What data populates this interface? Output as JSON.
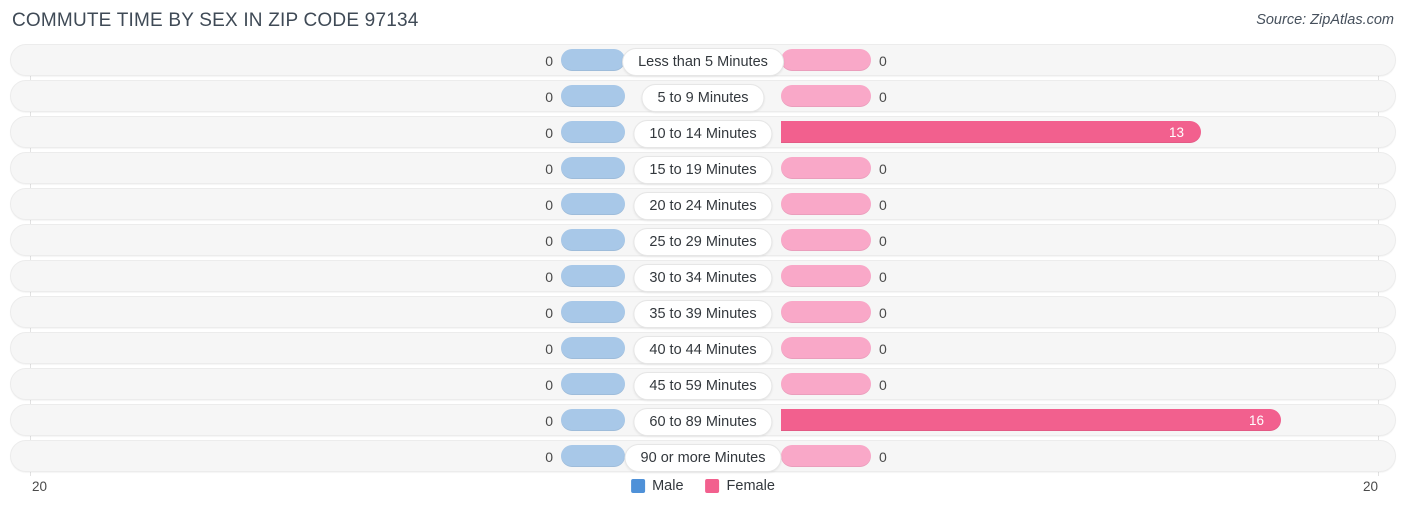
{
  "header": {
    "title": "COMMUTE TIME BY SEX IN ZIP CODE 97134",
    "source": "Source: ZipAtlas.com"
  },
  "legend": {
    "male": {
      "label": "Male",
      "color": "#4f91d8",
      "icon": "square-swatch"
    },
    "female": {
      "label": "Female",
      "color": "#f2608e",
      "icon": "square-swatch"
    }
  },
  "axis": {
    "min_label": "20",
    "max_label": "20"
  },
  "colors": {
    "male_bar": "#a8c8e8",
    "female_bar": "#f9a8c8",
    "female_bar_active": "#f2608e",
    "row_track": "#f6f6f6",
    "title": "#3f4a56"
  },
  "chart_data": {
    "type": "bar",
    "title": "COMMUTE TIME BY SEX IN ZIP CODE 97134",
    "xlabel": "",
    "ylabel": "",
    "orientation": "horizontal",
    "layout": "diverging-centered",
    "grid": false,
    "legend_position": "bottom-center",
    "axis_max": 20,
    "xlim": [
      20,
      20
    ],
    "categories": [
      "Less than 5 Minutes",
      "5 to 9 Minutes",
      "10 to 14 Minutes",
      "15 to 19 Minutes",
      "20 to 24 Minutes",
      "25 to 29 Minutes",
      "30 to 34 Minutes",
      "35 to 39 Minutes",
      "40 to 44 Minutes",
      "45 to 59 Minutes",
      "60 to 89 Minutes",
      "90 or more Minutes"
    ],
    "series": [
      {
        "name": "Male",
        "color": "#4f91d8",
        "values": [
          0,
          0,
          0,
          0,
          0,
          0,
          0,
          0,
          0,
          0,
          0,
          0
        ]
      },
      {
        "name": "Female",
        "color": "#f2608e",
        "values": [
          0,
          0,
          13,
          0,
          0,
          0,
          0,
          0,
          0,
          0,
          16,
          0
        ]
      }
    ]
  },
  "rows": [
    {
      "label": "Less than 5 Minutes",
      "male": "0",
      "female": "0",
      "male_w": 64,
      "female_w": 90,
      "female_hot": false
    },
    {
      "label": "5 to 9 Minutes",
      "male": "0",
      "female": "0",
      "male_w": 64,
      "female_w": 90,
      "female_hot": false
    },
    {
      "label": "10 to 14 Minutes",
      "male": "0",
      "female": "13",
      "male_w": 64,
      "female_w": 420,
      "female_hot": true
    },
    {
      "label": "15 to 19 Minutes",
      "male": "0",
      "female": "0",
      "male_w": 64,
      "female_w": 90,
      "female_hot": false
    },
    {
      "label": "20 to 24 Minutes",
      "male": "0",
      "female": "0",
      "male_w": 64,
      "female_w": 90,
      "female_hot": false
    },
    {
      "label": "25 to 29 Minutes",
      "male": "0",
      "female": "0",
      "male_w": 64,
      "female_w": 90,
      "female_hot": false
    },
    {
      "label": "30 to 34 Minutes",
      "male": "0",
      "female": "0",
      "male_w": 64,
      "female_w": 90,
      "female_hot": false
    },
    {
      "label": "35 to 39 Minutes",
      "male": "0",
      "female": "0",
      "male_w": 64,
      "female_w": 90,
      "female_hot": false
    },
    {
      "label": "40 to 44 Minutes",
      "male": "0",
      "female": "0",
      "male_w": 64,
      "female_w": 90,
      "female_hot": false
    },
    {
      "label": "45 to 59 Minutes",
      "male": "0",
      "female": "0",
      "male_w": 64,
      "female_w": 90,
      "female_hot": false
    },
    {
      "label": "60 to 89 Minutes",
      "male": "0",
      "female": "16",
      "male_w": 64,
      "female_w": 500,
      "female_hot": true
    },
    {
      "label": "90 or more Minutes",
      "male": "0",
      "female": "0",
      "male_w": 64,
      "female_w": 90,
      "female_hot": false
    }
  ]
}
